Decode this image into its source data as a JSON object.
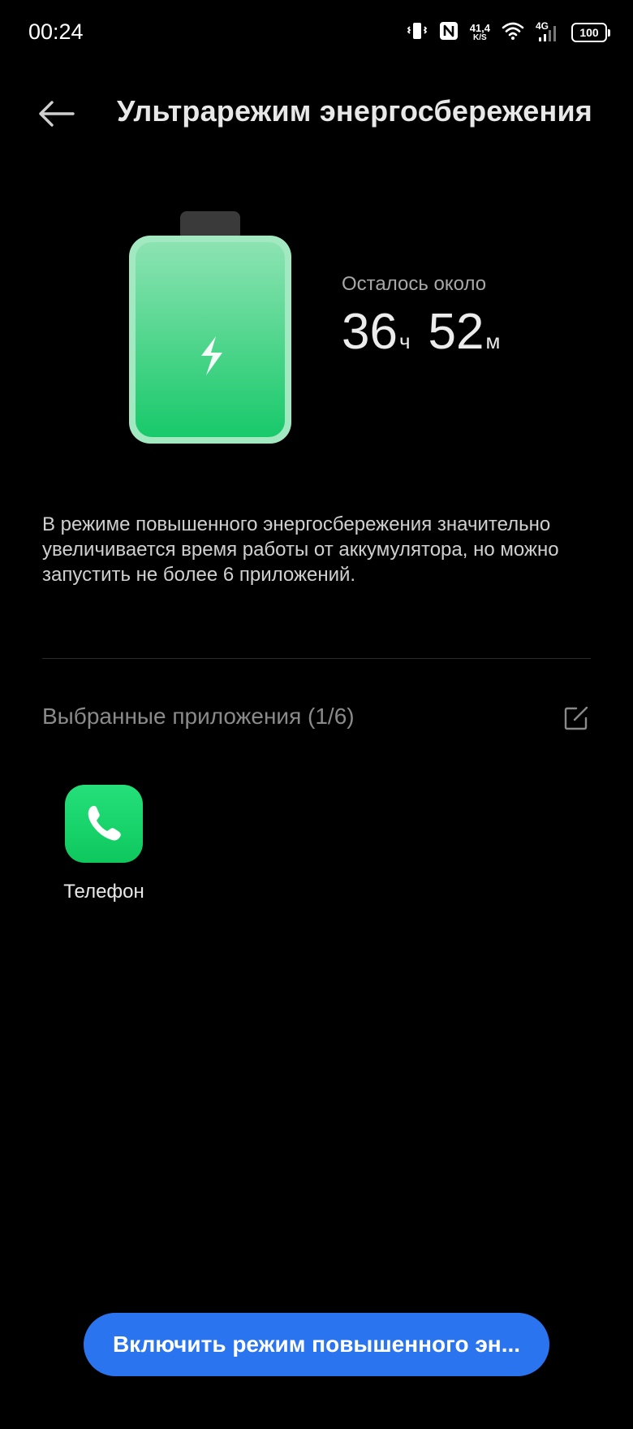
{
  "status_bar": {
    "time": "00:24",
    "net_speed_value": "41,4",
    "net_speed_unit": "K/S",
    "network_type": "4G",
    "battery_level": "100",
    "icons": [
      "vibrate-icon",
      "nfc-icon",
      "wifi-icon",
      "signal-icon",
      "battery-icon"
    ]
  },
  "header": {
    "title": "Ультрарежим энергосбережения",
    "back_icon": "arrow-left-icon"
  },
  "battery": {
    "remaining_label": "Осталось около",
    "hours": "36",
    "hours_unit": "ч",
    "minutes": "52",
    "minutes_unit": "м",
    "fill_color": "#2fd17a"
  },
  "description": "В режиме повышенного энергосбережения значительно увеличивается время работы от аккумулятора, но можно запустить не более 6 приложений.",
  "selected_apps": {
    "title": "Выбранные приложения (1/6)",
    "edit_icon": "edit-icon",
    "apps": [
      {
        "label": "Телефон",
        "icon": "phone-icon",
        "color": "#1fd86c"
      }
    ]
  },
  "enable_button": {
    "label": "Включить режим повышенного эн...",
    "color": "#2a74f0"
  }
}
